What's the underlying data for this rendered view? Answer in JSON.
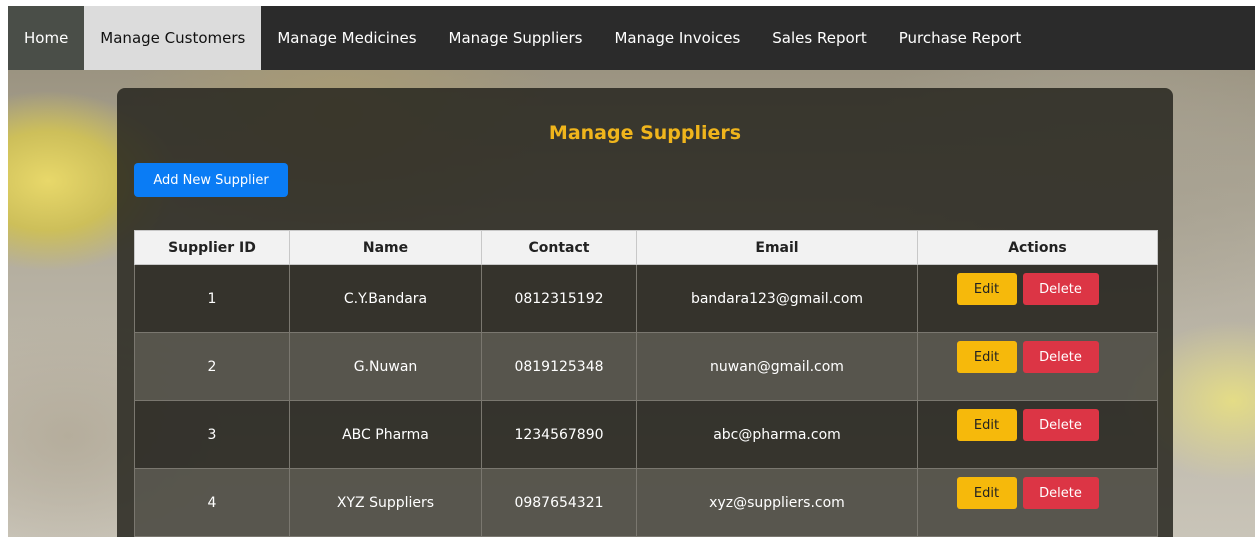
{
  "nav": {
    "items": [
      {
        "label": "Home"
      },
      {
        "label": "Manage Customers"
      },
      {
        "label": "Manage Medicines"
      },
      {
        "label": "Manage Suppliers"
      },
      {
        "label": "Manage Invoices"
      },
      {
        "label": "Sales Report"
      },
      {
        "label": "Purchase Report"
      }
    ]
  },
  "page": {
    "title": "Manage Suppliers",
    "add_button": "Add New Supplier"
  },
  "table": {
    "headers": [
      "Supplier ID",
      "Name",
      "Contact",
      "Email",
      "Actions"
    ],
    "rows": [
      {
        "id": "1",
        "name": "C.Y.Bandara",
        "contact": "0812315192",
        "email": "bandara123@gmail.com",
        "edit": "Edit",
        "delete": "Delete"
      },
      {
        "id": "2",
        "name": "G.Nuwan",
        "contact": "0819125348",
        "email": "nuwan@gmail.com",
        "edit": "Edit",
        "delete": "Delete"
      },
      {
        "id": "3",
        "name": "ABC Pharma",
        "contact": "1234567890",
        "email": "abc@pharma.com",
        "edit": "Edit",
        "delete": "Delete"
      },
      {
        "id": "4",
        "name": "XYZ Suppliers",
        "contact": "0987654321",
        "email": "xyz@suppliers.com",
        "edit": "Edit",
        "delete": "Delete"
      }
    ]
  },
  "colors": {
    "title": "#f0b51c",
    "add_button": "#0a7cf5",
    "edit_button": "#f6b90b",
    "delete_button": "#dc3545",
    "navbar": "#2b2b2b"
  }
}
